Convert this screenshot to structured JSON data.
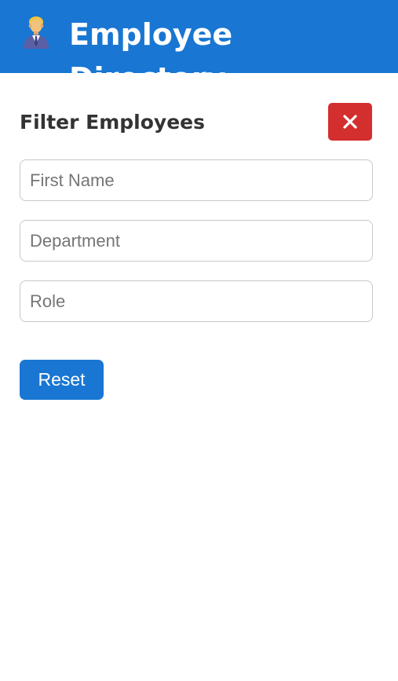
{
  "header": {
    "title": "Employee Directory",
    "icon": "office-worker-icon"
  },
  "filter_panel": {
    "title": "Filter Employees",
    "close_icon": "close-icon",
    "fields": {
      "first_name_placeholder": "First Name",
      "department_placeholder": "Department",
      "role_placeholder": "Role"
    },
    "reset_label": "Reset"
  },
  "colors": {
    "primary": "#1976d2",
    "danger": "#d32f2f",
    "text": "#333333"
  }
}
